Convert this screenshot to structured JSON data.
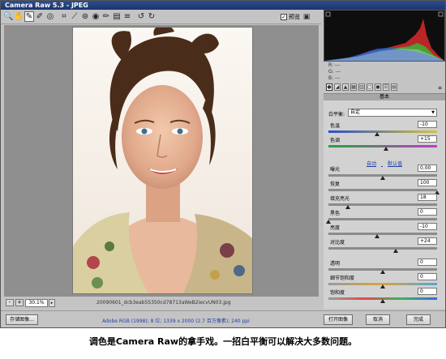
{
  "window": {
    "title": "Camera Raw 5.3 - JPEG"
  },
  "toolbar": {
    "tools": [
      {
        "name": "zoom-tool",
        "icon": "magnifier-icon",
        "glyph": "🔍"
      },
      {
        "name": "hand-tool",
        "icon": "hand-icon",
        "glyph": "✋"
      },
      {
        "name": "white-balance-tool",
        "icon": "eyedropper-icon",
        "glyph": "✎"
      },
      {
        "name": "color-sampler-tool",
        "icon": "sampler-icon",
        "glyph": "✐"
      },
      {
        "name": "targeted-adjust-tool",
        "icon": "target-icon",
        "glyph": "◎"
      },
      {
        "name": "crop-tool",
        "icon": "crop-icon",
        "glyph": "⌗"
      },
      {
        "name": "straighten-tool",
        "icon": "straighten-icon",
        "glyph": "⟋"
      },
      {
        "name": "spot-removal-tool",
        "icon": "spot-icon",
        "glyph": "⊛"
      },
      {
        "name": "red-eye-tool",
        "icon": "eye-icon",
        "glyph": "◉"
      },
      {
        "name": "adjustment-brush-tool",
        "icon": "brush-icon",
        "glyph": "✏"
      },
      {
        "name": "graduated-filter-tool",
        "icon": "gradient-icon",
        "glyph": "▤"
      },
      {
        "name": "preferences-tool",
        "icon": "list-icon",
        "glyph": "≡"
      },
      {
        "name": "rotate-left-tool",
        "icon": "rotate-left-icon",
        "glyph": "↺"
      },
      {
        "name": "rotate-right-tool",
        "icon": "rotate-right-icon",
        "glyph": "↻"
      }
    ],
    "preview_label": "预览",
    "preview_checked": true
  },
  "status": {
    "zoom_minus": "-",
    "zoom_plus": "+",
    "zoom_value": "30.1%",
    "filename": "20090601_dcb3eab55350cd78713aWeB2iecvUN03.jpg"
  },
  "bottom": {
    "save_label": "存储图像...",
    "workflow_text": "Adobe RGB (1998); 8 位; 1339 x 2000 (2.7 百万像素); 240 ppi",
    "open_label": "打开图像",
    "cancel_label": "取消",
    "done_label": "完成"
  },
  "rgb": {
    "r": "R:  ---",
    "g": "G:  ---",
    "b": "B:  ---"
  },
  "tabs": [
    "basic-icon",
    "tone-curve-icon",
    "detail-icon",
    "hsl-icon",
    "split-toning-icon",
    "lens-icon",
    "camera-calibration-icon",
    "presets-icon",
    "snapshots-icon"
  ],
  "panel": {
    "header": "基本",
    "wb_label": "白平衡:",
    "wb_value": "自定",
    "auto_label": "自动",
    "default_label": "默认值",
    "controls": [
      {
        "key": "temp",
        "label": "色温",
        "value": "-10",
        "level": 0.45,
        "track": "temp"
      },
      {
        "key": "tint",
        "label": "色调",
        "value": "+15",
        "level": 0.53,
        "track": "tint"
      },
      {
        "key": "exposure",
        "label": "曝光",
        "value": "0.00",
        "level": 0.5,
        "track": ""
      },
      {
        "key": "recovery",
        "label": "恢复",
        "value": "100",
        "level": 1.0,
        "track": ""
      },
      {
        "key": "fill",
        "label": "填充亮光",
        "value": "18",
        "level": 0.18,
        "track": ""
      },
      {
        "key": "blacks",
        "label": "黑色",
        "value": "0",
        "level": 0.0,
        "track": ""
      },
      {
        "key": "brightness",
        "label": "亮度",
        "value": "-10",
        "level": 0.45,
        "track": ""
      },
      {
        "key": "contrast",
        "label": "对比度",
        "value": "+24",
        "level": 0.62,
        "track": ""
      },
      {
        "key": "clarity",
        "label": "透明",
        "value": "0",
        "level": 0.5,
        "track": ""
      },
      {
        "key": "vibrance",
        "label": "细节饱和度",
        "value": "0",
        "level": 0.5,
        "track": "vib"
      },
      {
        "key": "saturation",
        "label": "饱和度",
        "value": "0",
        "level": 0.5,
        "track": "sat"
      }
    ]
  },
  "caption": "调色是Camera Raw的拿手戏。一招白平衡可以解决大多数问题。"
}
